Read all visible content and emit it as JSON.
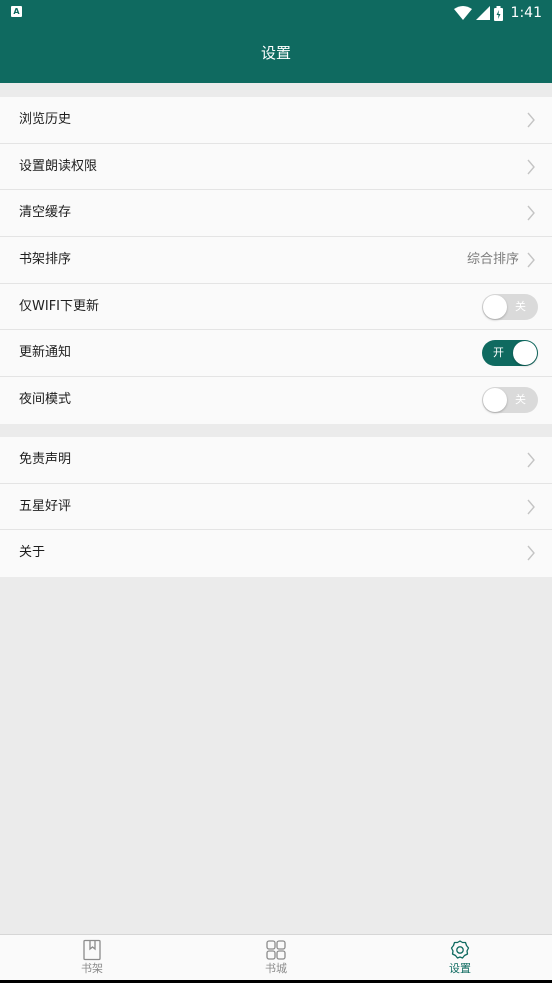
{
  "status_bar": {
    "notification_badge": "A",
    "time": "1:41",
    "icons": [
      "wifi-icon",
      "signal-icon",
      "battery-charging-icon"
    ]
  },
  "header": {
    "title": "设置"
  },
  "settings": {
    "group1": [
      {
        "label": "浏览历史"
      },
      {
        "label": "设置朗读权限"
      },
      {
        "label": "清空缓存"
      },
      {
        "label": "书架排序",
        "value": "综合排序"
      },
      {
        "label": "仅WIFI下更新",
        "toggle_text": "关",
        "toggle_on": false
      },
      {
        "label": "更新通知",
        "toggle_text": "开",
        "toggle_on": true
      },
      {
        "label": "夜间模式",
        "toggle_text": "关",
        "toggle_on": false
      }
    ],
    "group2": [
      {
        "label": "免责声明"
      },
      {
        "label": "五星好评"
      },
      {
        "label": "关于"
      }
    ]
  },
  "bottom_nav": {
    "active": "settings",
    "items": [
      {
        "label": "书架",
        "icon": "bookshelf-icon"
      },
      {
        "label": "书城",
        "icon": "grid-icon"
      },
      {
        "label": "设置",
        "icon": "gear-icon"
      }
    ]
  },
  "colors": {
    "primary": "#0f6a60",
    "background": "#ebebeb",
    "toggle_off": "#dadada"
  }
}
